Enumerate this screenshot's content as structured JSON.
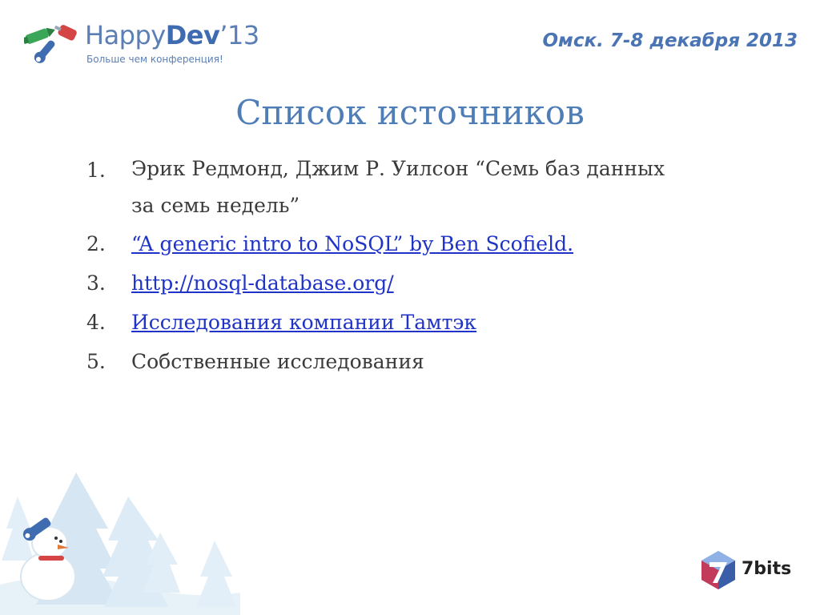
{
  "header": {
    "brand_happy": "Happy",
    "brand_dev": "Dev",
    "brand_year": "’13",
    "tagline": "Больше чем конференция!",
    "event": "Омск. 7-8 декабря 2013"
  },
  "slide": {
    "title": "Список источников",
    "items": [
      {
        "number": "1.",
        "line1": "Эрик Редмонд, Джим Р. Уилсон “Семь баз  данных",
        "line2": "за семь недель”",
        "is_link": false
      },
      {
        "number": "2.",
        "text": "“A generic intro to NoSQL” by Ben Scofield.",
        "is_link": true
      },
      {
        "number": "3.",
        "text": "http://nosql-database.org/",
        "is_link": true
      },
      {
        "number": "4.",
        "text": "Исследования компании Тамтэк",
        "is_link": true
      },
      {
        "number": "5.",
        "text": "Собственные исследования",
        "is_link": false
      }
    ]
  },
  "footer": {
    "sponsor": "7bits",
    "decoration_icon": "snowman-winter-scene-icon",
    "sponsor_icon": "7bits-logo-icon"
  },
  "colors": {
    "brand_blue": "#4f7db6",
    "link_blue": "#1f33c8",
    "body_text": "#3b3b3b",
    "accent_red": "#d64545",
    "accent_green": "#3aa657"
  }
}
